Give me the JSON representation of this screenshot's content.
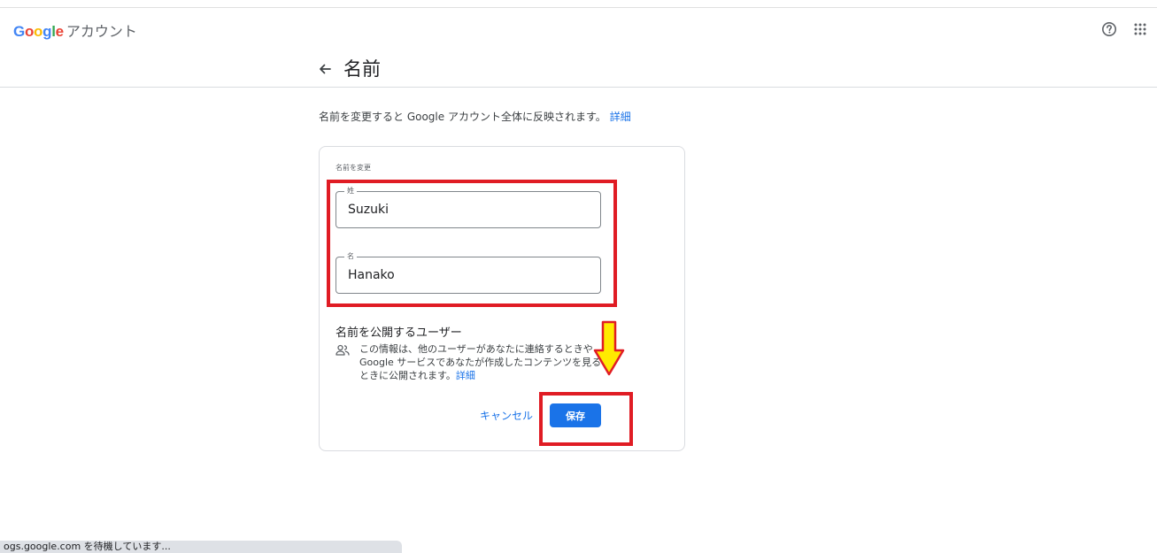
{
  "header": {
    "logo_text": "Google",
    "product_name": "アカウント",
    "help_icon": "help-circle-icon",
    "apps_icon": "apps-grid-icon"
  },
  "page": {
    "title": "名前",
    "back_icon": "arrow-back-icon",
    "description": "名前を変更すると Google アカウント全体に反映されます。",
    "description_link": "詳細"
  },
  "card": {
    "label": "名前を変更",
    "last_name": {
      "label": "姓",
      "value": "Suzuki"
    },
    "first_name": {
      "label": "名",
      "value": "Hanako"
    },
    "visibility": {
      "title": "名前を公開するユーザー",
      "icon": "people-icon",
      "text": "この情報は、他のユーザーがあなたに連絡するときや Google サービスであなたが作成したコンテンツを見るときに公開されます。",
      "link": "詳細"
    },
    "cancel_label": "キャンセル",
    "save_label": "保存"
  },
  "annotations": {
    "highlight_color": "#e01c24",
    "arrow_color": "#ffea00"
  },
  "status_bar": {
    "text": "ogs.google.com を待機しています..."
  },
  "colors": {
    "accent": "#1a73e8",
    "google_blue": "#4285f4",
    "google_red": "#ea4335",
    "google_yellow": "#fbbc05",
    "google_green": "#34a853"
  }
}
